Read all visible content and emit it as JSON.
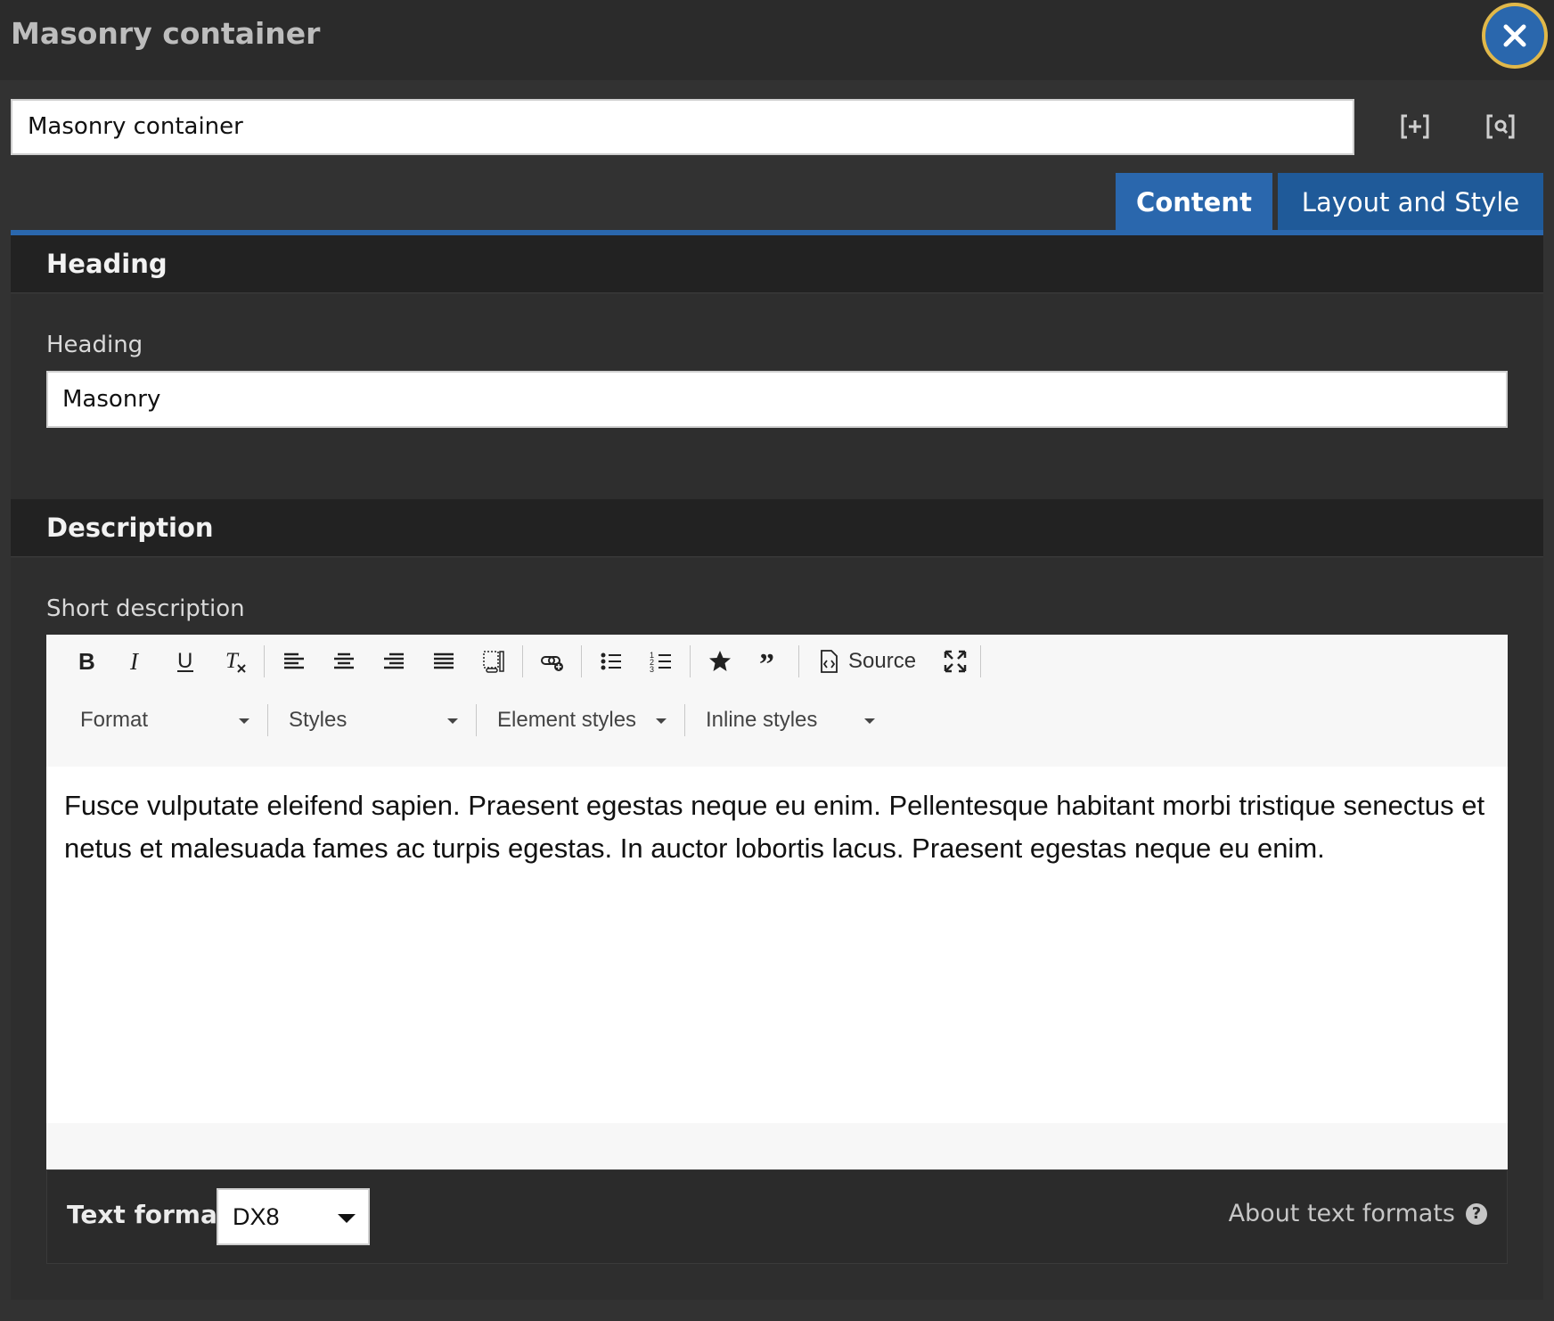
{
  "dialog": {
    "title": "Masonry container",
    "name_value": "Masonry container",
    "close_icon": "close-icon",
    "header_icons": [
      "expand-all-icon",
      "preview-icon"
    ]
  },
  "tabs": [
    {
      "label": "Content",
      "active": true
    },
    {
      "label": "Layout and Style",
      "active": false
    }
  ],
  "sections": {
    "heading": {
      "title": "Heading",
      "field_label": "Heading",
      "field_value": "Masonry"
    },
    "description": {
      "title": "Description",
      "field_label": "Short description"
    }
  },
  "editor": {
    "toolbar_buttons": [
      "bold-icon",
      "italic-icon",
      "underline-icon",
      "remove-format-icon",
      "align-left-icon",
      "align-center-icon",
      "align-right-icon",
      "align-justify-icon",
      "template-icon",
      "link-icon",
      "bulleted-list-icon",
      "numbered-list-icon",
      "star-icon",
      "blockquote-icon",
      "source-icon",
      "maximize-icon"
    ],
    "source_label": "Source",
    "dropdowns": [
      "Format",
      "Styles",
      "Element styles",
      "Inline styles"
    ],
    "content": "Fusce vulputate eleifend sapien. Praesent egestas neque eu enim. Pellentesque habitant morbi tristique senectus et netus et malesuada fames ac turpis egestas. In auctor lobortis lacus. Praesent egestas neque eu enim."
  },
  "text_format": {
    "label": "Text format",
    "selected": "DX8",
    "about_link": "About text formats",
    "help_icon": "help-icon"
  },
  "colors": {
    "accent": "#2a67ad",
    "close_ring": "#e0b84a",
    "background": "#2b2b2b"
  }
}
